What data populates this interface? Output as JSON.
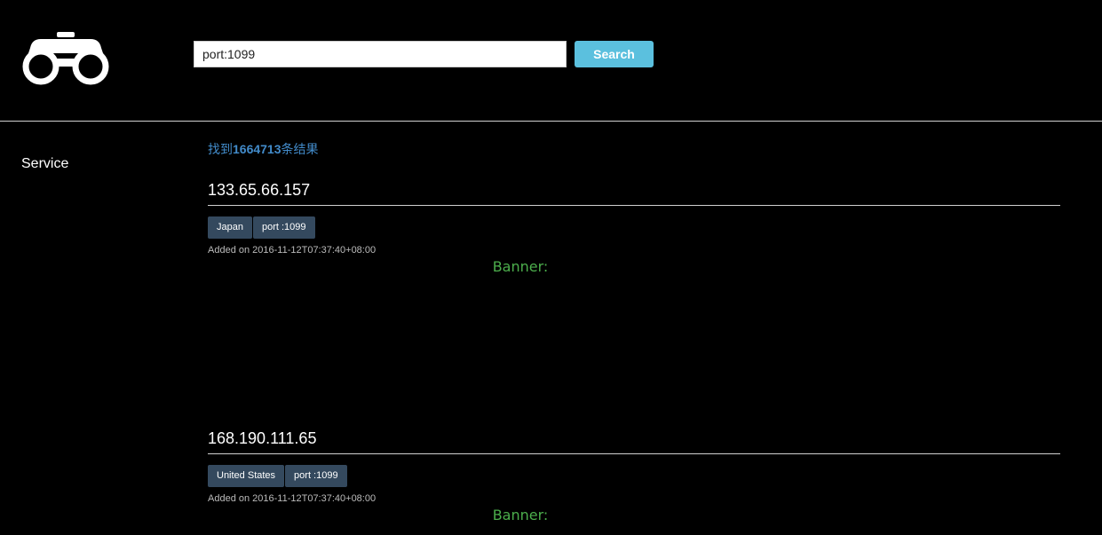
{
  "header": {
    "logo_icon": "binoculars-icon",
    "search": {
      "value": "port:1099",
      "button_label": "Search"
    }
  },
  "sidebar": {
    "service_label": "Service"
  },
  "results": {
    "count_prefix": "找到",
    "count": "1664713",
    "count_suffix": "条结果",
    "items": [
      {
        "ip": "133.65.66.157",
        "tags": [
          "Japan",
          "port :1099"
        ],
        "added_on": "Added on 2016-11-12T07:37:40+08:00",
        "banner_label": "Banner:"
      },
      {
        "ip": "168.190.111.65",
        "tags": [
          "United States",
          "port :1099"
        ],
        "added_on": "Added on 2016-11-12T07:37:40+08:00",
        "banner_label": "Banner:"
      }
    ]
  },
  "colors": {
    "background": "#000000",
    "search_button": "#5bc0de",
    "link_blue": "#428bca",
    "tag_background": "#34495e",
    "banner_green": "#4cae4c"
  }
}
